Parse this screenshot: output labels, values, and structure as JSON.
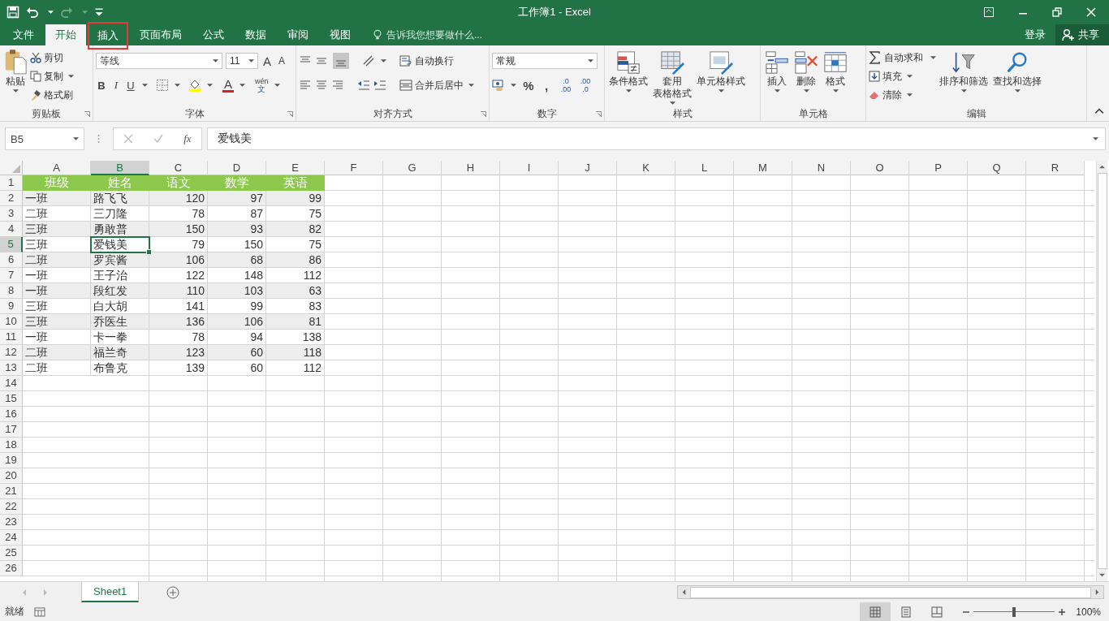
{
  "title_bar": {
    "title": "工作簿1 - Excel"
  },
  "tabs": [
    {
      "label": "文件",
      "selected": false,
      "highlighted": false
    },
    {
      "label": "开始",
      "selected": true,
      "highlighted": false
    },
    {
      "label": "插入",
      "selected": false,
      "highlighted": true
    },
    {
      "label": "页面布局",
      "selected": false,
      "highlighted": false
    },
    {
      "label": "公式",
      "selected": false,
      "highlighted": false
    },
    {
      "label": "数据",
      "selected": false,
      "highlighted": false
    },
    {
      "label": "审阅",
      "selected": false,
      "highlighted": false
    },
    {
      "label": "视图",
      "selected": false,
      "highlighted": false
    }
  ],
  "tell_me": {
    "placeholder": "告诉我您想要做什么..."
  },
  "sign_in": "登录",
  "share": "共享",
  "ribbon": {
    "clipboard": {
      "label": "剪贴板",
      "paste": "粘贴",
      "cut": "剪切",
      "copy": "复制",
      "format_painter": "格式刷"
    },
    "font": {
      "label": "字体",
      "font_name": "等线",
      "font_size": "11",
      "grow": "A",
      "shrink": "A",
      "bold": "B",
      "italic": "I",
      "underline": "U",
      "font_color": "A",
      "phonetic": "wén",
      "phonetic_base": "文"
    },
    "alignment": {
      "label": "对齐方式",
      "wrap_text": "自动换行",
      "merge_center": "合并后居中"
    },
    "number": {
      "label": "数字",
      "format": "常规",
      "percent": "%",
      "comma": ",",
      "increase_decimal": [
        ".0",
        ".00"
      ],
      "decrease_decimal": [
        ".00",
        ".0"
      ]
    },
    "styles": {
      "label": "样式",
      "buttons": [
        {
          "kind": "conditional",
          "lines": [
            "条件格式"
          ]
        },
        {
          "kind": "table",
          "lines": [
            "套用",
            "表格格式"
          ]
        },
        {
          "kind": "cellstyle",
          "lines": [
            "单元格样式"
          ]
        }
      ]
    },
    "cells": {
      "label": "单元格",
      "buttons": [
        {
          "kind": "insert",
          "lines": [
            "插入"
          ]
        },
        {
          "kind": "delete",
          "lines": [
            "删除"
          ]
        },
        {
          "kind": "format",
          "lines": [
            "格式"
          ]
        }
      ]
    },
    "editing": {
      "label": "编辑",
      "autosum": "自动求和",
      "fill": "填充",
      "clear": "清除",
      "sort_filter": "排序和筛选",
      "find_select": "查找和选择"
    }
  },
  "formula_bar": {
    "name_box": "B5",
    "function_label": "fx",
    "formula": "爱钱美"
  },
  "sheet": {
    "columns": [
      {
        "label": "A",
        "selected": false
      },
      {
        "label": "B",
        "selected": true
      },
      {
        "label": "C",
        "selected": false
      },
      {
        "label": "D",
        "selected": false
      },
      {
        "label": "E",
        "selected": false
      },
      {
        "label": "F",
        "selected": false
      },
      {
        "label": "G",
        "selected": false
      },
      {
        "label": "H",
        "selected": false
      },
      {
        "label": "I",
        "selected": false
      },
      {
        "label": "J",
        "selected": false
      },
      {
        "label": "K",
        "selected": false
      },
      {
        "label": "L",
        "selected": false
      },
      {
        "label": "M",
        "selected": false
      },
      {
        "label": "N",
        "selected": false
      },
      {
        "label": "O",
        "selected": false
      },
      {
        "label": "P",
        "selected": false
      },
      {
        "label": "Q",
        "selected": false
      },
      {
        "label": "R",
        "selected": false
      }
    ],
    "row_numbers": [
      {
        "label": "1",
        "selected": false
      },
      {
        "label": "2",
        "selected": false
      },
      {
        "label": "3",
        "selected": false
      },
      {
        "label": "4",
        "selected": false
      },
      {
        "label": "5",
        "selected": true
      },
      {
        "label": "6",
        "selected": false
      },
      {
        "label": "7",
        "selected": false
      },
      {
        "label": "8",
        "selected": false
      },
      {
        "label": "9",
        "selected": false
      },
      {
        "label": "10",
        "selected": false
      },
      {
        "label": "11",
        "selected": false
      },
      {
        "label": "12",
        "selected": false
      },
      {
        "label": "13",
        "selected": false
      },
      {
        "label": "14",
        "selected": false
      },
      {
        "label": "15",
        "selected": false
      },
      {
        "label": "16",
        "selected": false
      },
      {
        "label": "17",
        "selected": false
      },
      {
        "label": "18",
        "selected": false
      },
      {
        "label": "19",
        "selected": false
      },
      {
        "label": "20",
        "selected": false
      },
      {
        "label": "21",
        "selected": false
      },
      {
        "label": "22",
        "selected": false
      },
      {
        "label": "23",
        "selected": false
      },
      {
        "label": "24",
        "selected": false
      },
      {
        "label": "25",
        "selected": false
      },
      {
        "label": "26",
        "selected": false
      }
    ],
    "rows": [
      {
        "kind": "header",
        "cells": [
          "班级",
          "姓名",
          "语文",
          "数学",
          "英语"
        ]
      },
      {
        "kind": "data",
        "cells": [
          "一班",
          "路飞飞",
          "120",
          "97",
          "99"
        ]
      },
      {
        "kind": "data",
        "cells": [
          "二班",
          "三刀隆",
          "78",
          "87",
          "75"
        ]
      },
      {
        "kind": "data",
        "cells": [
          "三班",
          "勇敢普",
          "150",
          "93",
          "82"
        ]
      },
      {
        "kind": "data",
        "cells": [
          "三班",
          "爱钱美",
          "79",
          "150",
          "75"
        ]
      },
      {
        "kind": "data",
        "cells": [
          "二班",
          "罗宾酱",
          "106",
          "68",
          "86"
        ]
      },
      {
        "kind": "data",
        "cells": [
          "一班",
          "王子治",
          "122",
          "148",
          "112"
        ]
      },
      {
        "kind": "data",
        "cells": [
          "一班",
          "段红发",
          "110",
          "103",
          "63"
        ]
      },
      {
        "kind": "data",
        "cells": [
          "三班",
          "白大胡",
          "141",
          "99",
          "83"
        ]
      },
      {
        "kind": "data",
        "cells": [
          "三班",
          "乔医生",
          "136",
          "106",
          "81"
        ]
      },
      {
        "kind": "data",
        "cells": [
          "一班",
          "卡一拳",
          "78",
          "94",
          "138"
        ]
      },
      {
        "kind": "data",
        "cells": [
          "二班",
          "福兰奇",
          "123",
          "60",
          "118"
        ]
      },
      {
        "kind": "data",
        "cells": [
          "二班",
          "布鲁克",
          "139",
          "60",
          "112"
        ]
      }
    ]
  },
  "sheet_tabs": [
    {
      "label": "Sheet1",
      "selected": true
    }
  ],
  "status_bar": {
    "status": "就绪",
    "views": [
      {
        "kind": "normal",
        "selected": true
      },
      {
        "kind": "page_layout",
        "selected": false
      },
      {
        "kind": "page_break",
        "selected": false
      }
    ],
    "zoom_slider": {
      "level": 0.5
    },
    "zoom": "100%"
  }
}
